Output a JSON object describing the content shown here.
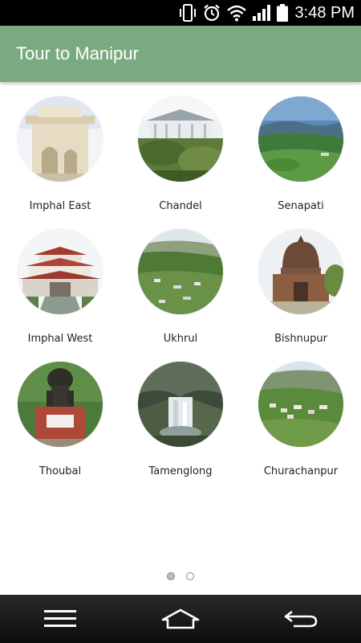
{
  "status_bar": {
    "time": "3:48 PM",
    "icons": [
      "vibrate-icon",
      "alarm-icon",
      "wifi-icon",
      "signal-icon",
      "battery-icon"
    ]
  },
  "app_bar": {
    "title": "Tour to Manipur",
    "color": "#7aaa80"
  },
  "districts": [
    {
      "label": "Imphal East",
      "image": "imphal-east-image"
    },
    {
      "label": "Chandel",
      "image": "chandel-image"
    },
    {
      "label": "Senapati",
      "image": "senapati-image"
    },
    {
      "label": "Imphal West",
      "image": "imphal-west-image"
    },
    {
      "label": "Ukhrul",
      "image": "ukhrul-image"
    },
    {
      "label": "Bishnupur",
      "image": "bishnupur-image"
    },
    {
      "label": "Thoubal",
      "image": "thoubal-image"
    },
    {
      "label": "Tamenglong",
      "image": "tamenglong-image"
    },
    {
      "label": "Churachanpur",
      "image": "churachanpur-image"
    }
  ],
  "pager": {
    "current_page": 1,
    "total_pages": 2
  },
  "nav_bar": {
    "buttons": [
      "menu-icon",
      "home-icon",
      "back-icon"
    ]
  }
}
